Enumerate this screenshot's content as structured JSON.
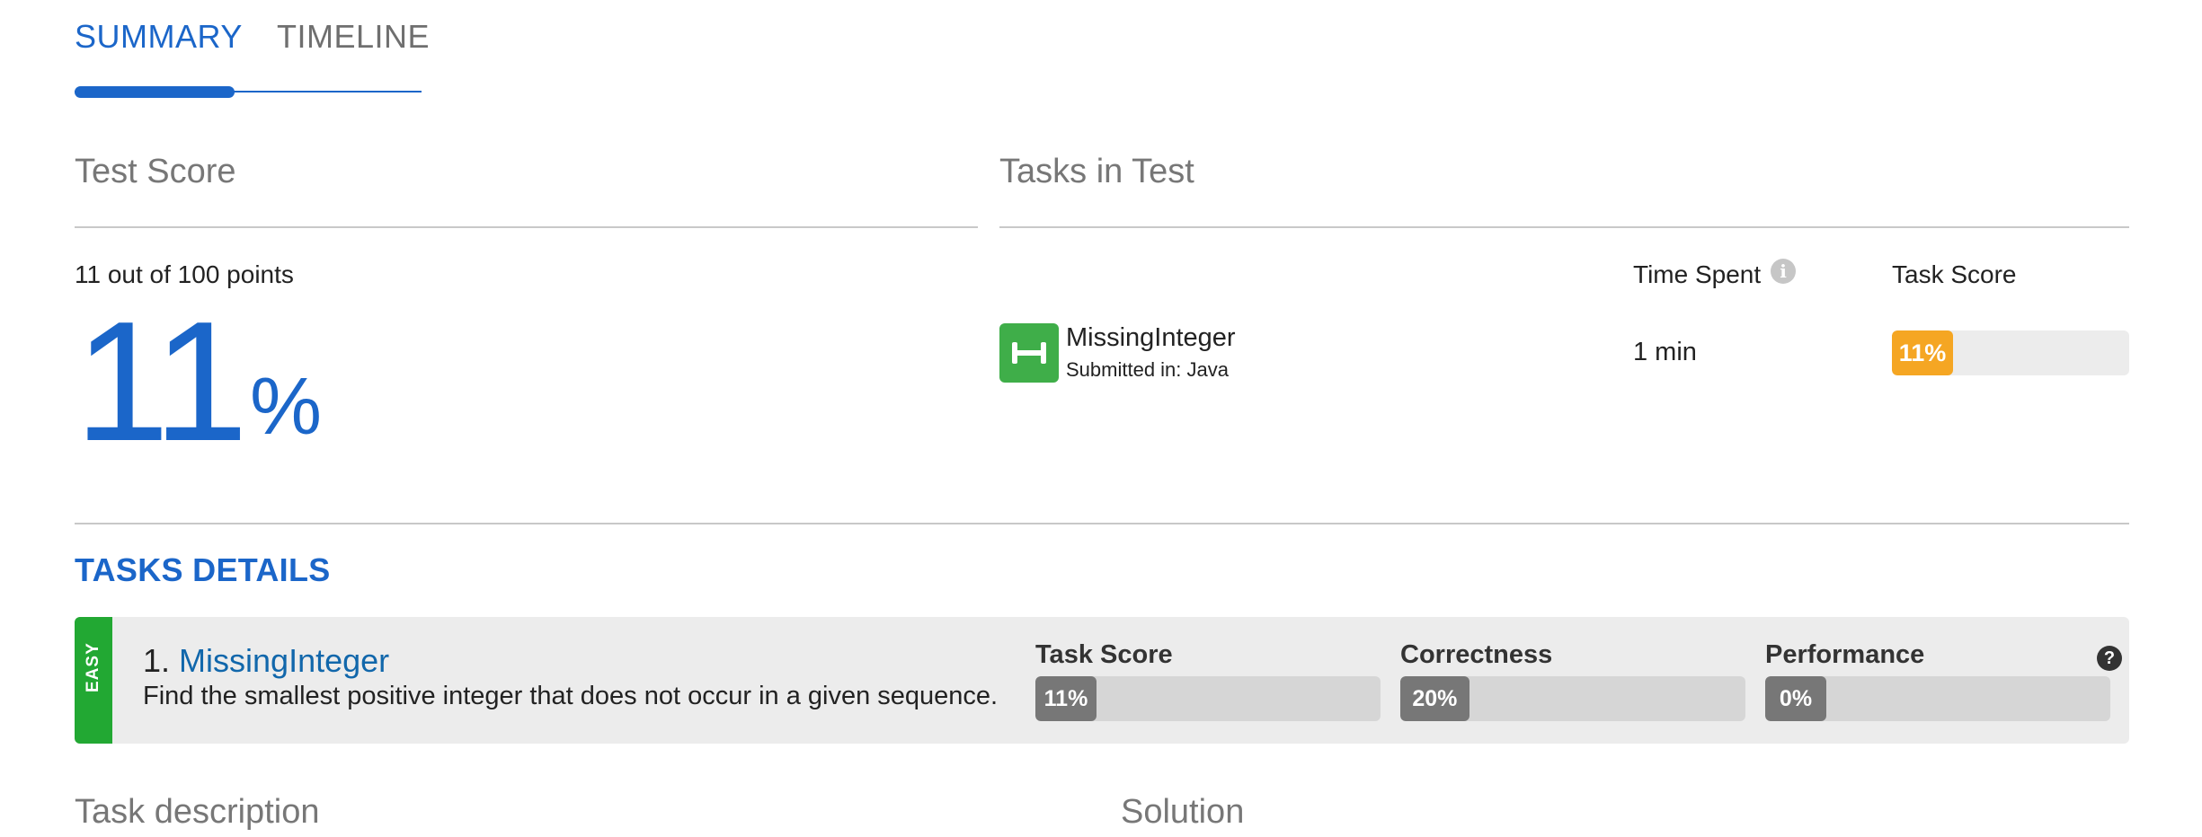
{
  "tabs": [
    {
      "label": "SUMMARY",
      "active": true
    },
    {
      "label": "TIMELINE",
      "active": false
    }
  ],
  "test_score": {
    "title": "Test Score",
    "points_text": "11 out of 100 points",
    "percent_value": "11",
    "percent_sign": "%"
  },
  "tasks_in_test": {
    "title": "Tasks in Test",
    "columns": {
      "time_spent": "Time Spent",
      "task_score": "Task Score"
    },
    "rows": [
      {
        "name": "MissingInteger",
        "submitted": "Submitted in: Java",
        "icon": "dumbbell-icon",
        "time_spent": "1 min",
        "score_label": "11%",
        "score_fraction": 0.11
      }
    ]
  },
  "tasks_details": {
    "title": "TASKS DETAILS",
    "items": [
      {
        "difficulty": "EASY",
        "number": "1.",
        "name": "MissingInteger",
        "description": "Find the smallest positive integer that does not occur in a given sequence.",
        "metrics": [
          {
            "label": "Task Score",
            "value_label": "11%",
            "fraction": 0.11
          },
          {
            "label": "Correctness",
            "value_label": "20%",
            "fraction": 0.2
          },
          {
            "label": "Performance",
            "value_label": "0%",
            "fraction": 0.0
          }
        ]
      }
    ]
  },
  "bottom_sections": {
    "task_description": "Task description",
    "solution": "Solution"
  },
  "colors": {
    "accent_blue": "#1b66c9",
    "link_blue": "#1167ab",
    "task_icon_green": "#3fae49",
    "easy_green": "#22a833",
    "score_orange": "#f5a623",
    "metric_gray": "#777777",
    "track_gray": "#ececec"
  }
}
